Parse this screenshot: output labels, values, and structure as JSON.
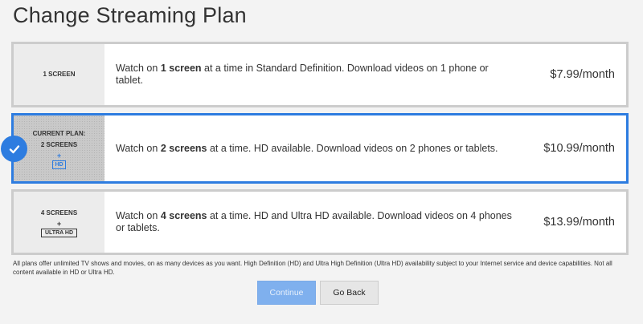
{
  "page": {
    "title": "Change Streaming Plan"
  },
  "plans": [
    {
      "screens_label": "1 SCREEN",
      "desc_pre": "Watch on ",
      "desc_bold": "1 screen",
      "desc_post": " at a time in Standard Definition. Download videos on 1 phone or tablet.",
      "price": "$7.99/month"
    },
    {
      "current_label": "CURRENT PLAN:",
      "screens_label": "2 SCREENS",
      "plus": "+",
      "badge": "HD",
      "desc_pre": "Watch on ",
      "desc_bold": "2 screens",
      "desc_post": " at a time. HD available. Download videos on 2 phones or tablets.",
      "price": "$10.99/month",
      "selected": true
    },
    {
      "screens_label": "4 SCREENS",
      "plus": "+",
      "badge": "ULTRA HD",
      "desc_pre": "Watch on ",
      "desc_bold": "4 screens",
      "desc_post": " at a time. HD and Ultra HD available. Download videos on 4 phones or tablets.",
      "price": "$13.99/month"
    }
  ],
  "footnote": "All plans offer unlimited TV shows and movies, on as many devices as you want. High Definition (HD) and Ultra High Definition (Ultra HD) availability subject to your Internet service and device capabilities. Not all content available in HD or Ultra HD.",
  "buttons": {
    "continue": "Continue",
    "back": "Go Back"
  },
  "colors": {
    "accent": "#2d7ce0",
    "continue_bg": "#7fb0ee"
  },
  "icons": {
    "selected_plan": "check-icon"
  }
}
